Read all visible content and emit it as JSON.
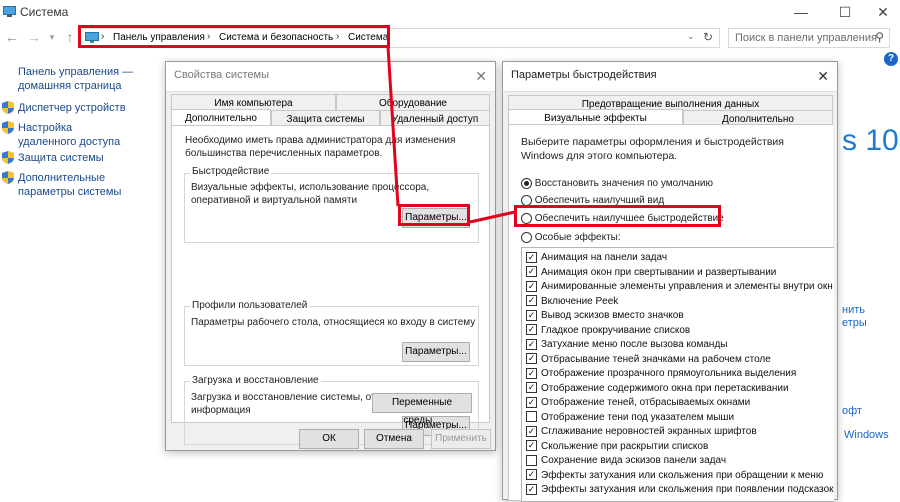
{
  "window": {
    "title": "Система",
    "controls": [
      "—",
      "☐",
      "✕"
    ]
  },
  "address": {
    "crumbs": [
      "Панель управления",
      "Система и безопасность",
      "Система"
    ],
    "search_placeholder": "Поиск в панели управления"
  },
  "sidebar": {
    "home": "Панель управления — домашняя страница",
    "items": [
      {
        "label": "Диспетчер устройств"
      },
      {
        "label": "Настройка удаленного доступа"
      },
      {
        "label": "Защита системы"
      },
      {
        "label": "Дополнительные параметры системы"
      }
    ]
  },
  "background": {
    "win10": "s 10",
    "right_links": [
      "нить",
      "етры",
      "офт",
      "Windows"
    ]
  },
  "sysprops": {
    "title": "Свойства системы",
    "tabs_row1": [
      "Имя компьютера",
      "Оборудование"
    ],
    "tabs_row2": [
      "Дополнительно",
      "Защита системы",
      "Удаленный доступ"
    ],
    "intro": "Необходимо иметь права администратора для изменения большинства перечисленных параметров.",
    "perf_title": "Быстродействие",
    "perf_text": "Визуальные эффекты, использование процессора, оперативной и виртуальной памяти",
    "params_btn": "Параметры...",
    "profiles_title": "Профили пользователей",
    "profiles_text": "Параметры рабочего стола, относящиеся ко входу в систему",
    "startup_title": "Загрузка и восстановление",
    "startup_text": "Загрузка и восстановление системы, отладочная информация",
    "env_btn": "Переменные среды...",
    "ok": "ОК",
    "cancel": "Отмена",
    "apply": "Применить"
  },
  "perf": {
    "title": "Параметры быстродействия",
    "tab_top": "Предотвращение выполнения данных",
    "tabs": [
      "Визуальные эффекты",
      "Дополнительно"
    ],
    "intro": "Выберите параметры оформления и быстродействия Windows для этого компьютера.",
    "radios": [
      {
        "label": "Восстановить значения по умолчанию",
        "checked": true
      },
      {
        "label": "Обеспечить наилучший вид",
        "checked": false
      },
      {
        "label": "Обеспечить наилучшее быстродействие",
        "checked": false
      },
      {
        "label": "Особые эффекты:",
        "checked": false
      }
    ],
    "effects": [
      {
        "label": "Анимация на панели задач",
        "checked": true
      },
      {
        "label": "Анимация окон при свертывании и развертывании",
        "checked": true
      },
      {
        "label": "Анимированные элементы управления и элементы внутри окн",
        "checked": true
      },
      {
        "label": "Включение Peek",
        "checked": true
      },
      {
        "label": "Вывод эскизов вместо значков",
        "checked": true
      },
      {
        "label": "Гладкое прокручивание списков",
        "checked": true
      },
      {
        "label": "Затухание меню после вызова команды",
        "checked": true
      },
      {
        "label": "Отбрасывание теней значками на рабочем столе",
        "checked": true
      },
      {
        "label": "Отображение прозрачного прямоугольника выделения",
        "checked": true
      },
      {
        "label": "Отображение содержимого окна при перетаскивании",
        "checked": true
      },
      {
        "label": "Отображение теней, отбрасываемых окнами",
        "checked": true
      },
      {
        "label": "Отображение тени под указателем мыши",
        "checked": false
      },
      {
        "label": "Сглаживание неровностей экранных шрифтов",
        "checked": true
      },
      {
        "label": "Скольжение при раскрытии списков",
        "checked": true
      },
      {
        "label": "Сохранение вида эскизов панели задач",
        "checked": false
      },
      {
        "label": "Эффекты затухания или скольжения при обращении к меню",
        "checked": true
      },
      {
        "label": "Эффекты затухания или скольжения при появлении подсказок",
        "checked": true
      }
    ]
  },
  "colors": {
    "highlight": "#e3001b",
    "link": "#1a4a8a"
  }
}
